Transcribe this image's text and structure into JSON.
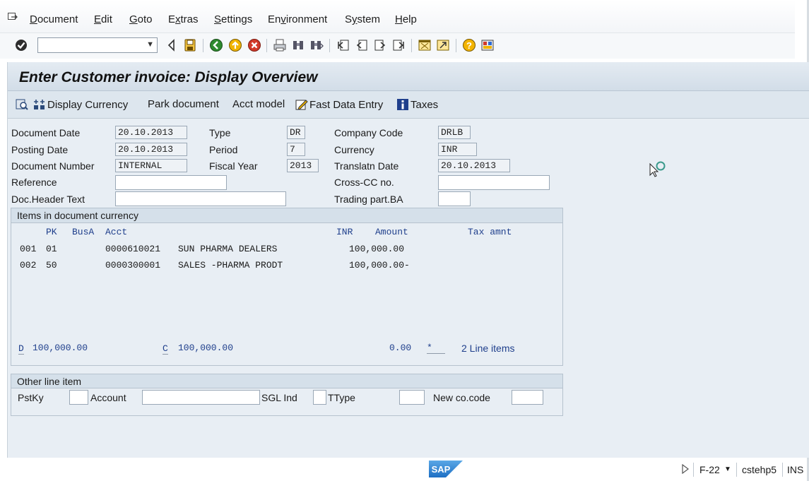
{
  "menu": {
    "items": [
      {
        "label": "Document",
        "u": "D"
      },
      {
        "label": "Edit",
        "u": "E"
      },
      {
        "label": "Goto",
        "u": "G"
      },
      {
        "label": "Extras",
        "u": "x"
      },
      {
        "label": "Settings",
        "u": "S"
      },
      {
        "label": "Environment",
        "u": "v"
      },
      {
        "label": "System",
        "u": "y"
      },
      {
        "label": "Help",
        "u": "H"
      }
    ]
  },
  "toolbar": {
    "command_field_value": "",
    "icons": [
      "enter-icon",
      "back-arrow-icon",
      "save-icon",
      "back-icon",
      "exit-icon",
      "cancel-icon",
      "print-icon",
      "find-icon",
      "find-next-icon",
      "first-page-icon",
      "previous-page-icon",
      "next-page-icon",
      "last-page-icon",
      "create-session-icon",
      "shortcut-icon",
      "help-icon",
      "layout-menu-icon"
    ]
  },
  "header": {
    "title": "Enter Customer invoice: Display Overview"
  },
  "app_toolbar": {
    "display_currency": "Display Currency",
    "park_document": "Park document",
    "acct_model": "Acct model",
    "fast_data_entry": "Fast Data Entry",
    "taxes": "Taxes"
  },
  "form": {
    "document_date_label": "Document Date",
    "document_date": "20.10.2013",
    "posting_date_label": "Posting Date",
    "posting_date": "20.10.2013",
    "document_number_label": "Document Number",
    "document_number": "INTERNAL",
    "reference_label": "Reference",
    "reference": "",
    "doc_header_text_label": "Doc.Header Text",
    "doc_header_text": "",
    "type_label": "Type",
    "type": "DR",
    "period_label": "Period",
    "period": "7",
    "fiscal_year_label": "Fiscal Year",
    "fiscal_year": "2013",
    "company_code_label": "Company Code",
    "company_code": "DRLB",
    "currency_label": "Currency",
    "currency": "INR",
    "translatn_date_label": "Translatn Date",
    "translatn_date": "20.10.2013",
    "cross_cc_label": "Cross-CC no.",
    "cross_cc": "",
    "trading_part_label": "Trading part.BA",
    "trading_part": ""
  },
  "items": {
    "title": "Items in document currency",
    "headers": {
      "pk": "PK",
      "busa": "BusA",
      "acct": "Acct",
      "currency": "INR",
      "amount": "Amount",
      "tax": "Tax amnt"
    },
    "rows": [
      {
        "no": "001",
        "pk": "01",
        "acct": "0000610021",
        "name": "SUN PHARMA DEALERS",
        "amount": "100,000.00"
      },
      {
        "no": "002",
        "pk": "50",
        "acct": "0000300001",
        "name": "SALES -PHARMA PRODT",
        "amount": "100,000.00-"
      }
    ],
    "debit_label": "D",
    "debit_total": "100,000.00",
    "credit_label": "C",
    "credit_total": "100,000.00",
    "balance": "0.00",
    "balance_flag": "*",
    "line_items": "2 Line items"
  },
  "other": {
    "title": "Other line item",
    "pstky_label": "PstKy",
    "account_label": "Account",
    "sgl_label": "SGL Ind",
    "ttype_label": "TType",
    "new_cocode_label": "New co.code"
  },
  "status": {
    "logo": "SAP",
    "tcode": "F-22",
    "server": "cstehp5",
    "mode": "INS"
  }
}
